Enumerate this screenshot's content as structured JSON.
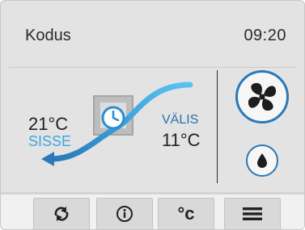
{
  "header": {
    "title": "Kodus",
    "clock": "09:20"
  },
  "inside": {
    "temperature": "21°C",
    "label": "SISSE"
  },
  "outside": {
    "label": "VÄLIS",
    "temperature": "11°C"
  },
  "bottom_bar": {
    "temperature_unit_label": "°c",
    "icons": [
      "refresh-arrows-icon",
      "info-icon",
      "temperature-unit-icon",
      "menu-icon"
    ]
  },
  "side_controls": {
    "icons": [
      "fan-icon",
      "water-drop-icon"
    ]
  },
  "colors": {
    "accent_blue": "#2a79b8",
    "light_blue": "#3aa9dd",
    "background": "#e3e3e3"
  }
}
